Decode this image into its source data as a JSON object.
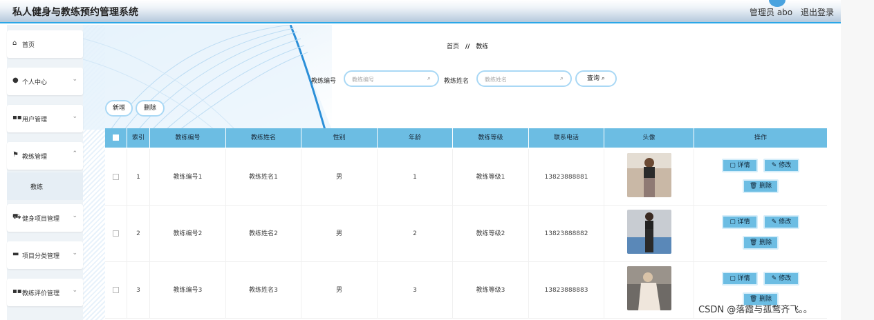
{
  "header": {
    "title": "私人健身与教练预约管理系统",
    "user": "管理员 abo",
    "logout": "退出登录"
  },
  "sidebar": {
    "items": [
      {
        "label": "首页",
        "icon": "home-icon",
        "has_chevron": false
      },
      {
        "label": "个人中心",
        "icon": "person-icon",
        "has_chevron": true
      },
      {
        "label": "用户管理",
        "icon": "grid-icon",
        "has_chevron": true
      },
      {
        "label": "教练管理",
        "icon": "flag-icon",
        "has_chevron": true
      },
      {
        "label": "健身项目管理",
        "icon": "car-icon",
        "has_chevron": true
      },
      {
        "label": "项目分类管理",
        "icon": "box-icon",
        "has_chevron": true
      },
      {
        "label": "教练评价管理",
        "icon": "grid-icon",
        "has_chevron": true
      }
    ],
    "submenu_label": "教练"
  },
  "breadcrumb": {
    "home": "首页",
    "sep": "//",
    "current": "教练"
  },
  "search": {
    "code_label": "教练编号",
    "code_placeholder": "教练编号",
    "name_label": "教练姓名",
    "name_placeholder": "教练姓名",
    "query_button": "查询"
  },
  "actions": {
    "add": "新增",
    "delete": "删除"
  },
  "table": {
    "columns": [
      "",
      "索引",
      "教练编号",
      "教练姓名",
      "性别",
      "年龄",
      "教练等级",
      "联系电话",
      "头像",
      "操作"
    ],
    "rows": [
      {
        "index": "1",
        "code": "教练编号1",
        "name": "教练姓名1",
        "gender": "男",
        "age": "1",
        "level": "教练等级1",
        "phone": "13823888881"
      },
      {
        "index": "2",
        "code": "教练编号2",
        "name": "教练姓名2",
        "gender": "男",
        "age": "2",
        "level": "教练等级2",
        "phone": "13823888882"
      },
      {
        "index": "3",
        "code": "教练编号3",
        "name": "教练姓名3",
        "gender": "男",
        "age": "3",
        "level": "教练等级3",
        "phone": "13823888883"
      }
    ],
    "row_buttons": {
      "detail": "详情",
      "edit": "修改",
      "delete": "删除"
    }
  },
  "watermark": "CSDN @落霞与孤鹜齐飞。。",
  "colors": {
    "accent": "#6cbde3",
    "header_line": "#2aa7e8",
    "border": "#a9d8f5"
  }
}
